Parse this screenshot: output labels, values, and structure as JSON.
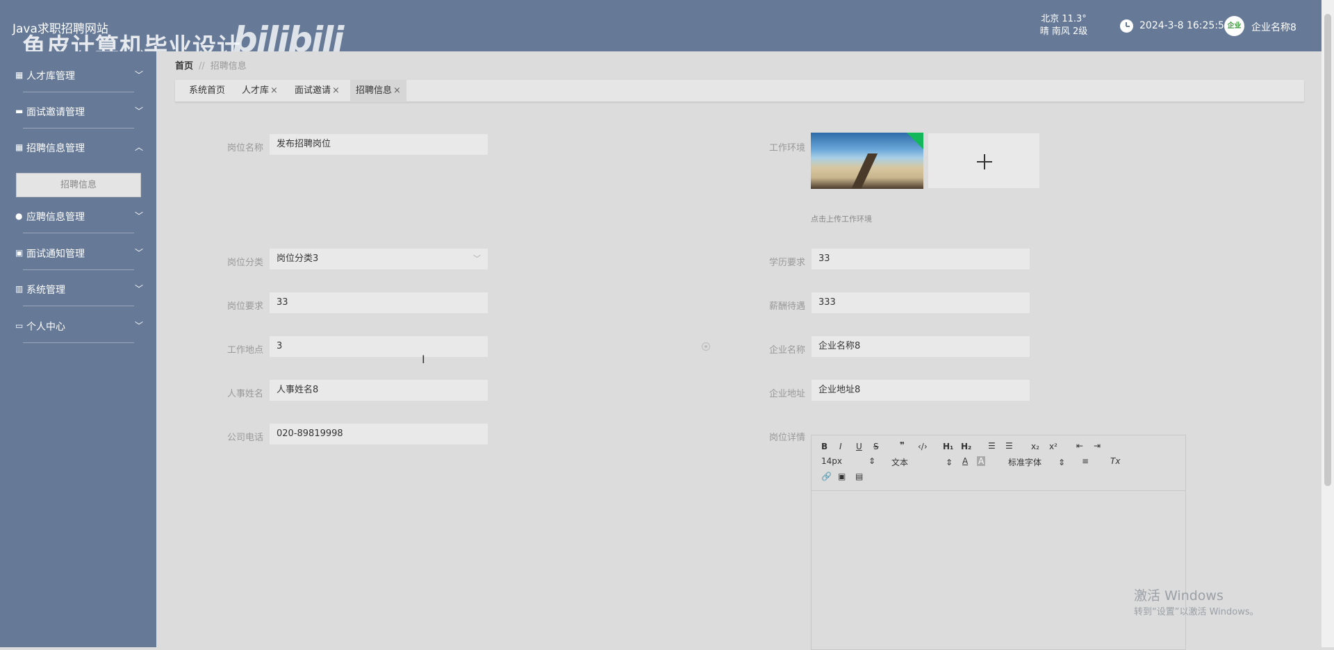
{
  "app": {
    "title": "Java求职招聘网站",
    "watermark_text": "鱼皮计算机毕业设计",
    "watermark_logo": "bilibili"
  },
  "header": {
    "weather_city": "北京 11.3°",
    "weather_desc": "晴 南风 2级",
    "datetime": "2024-3-8 16:25:54",
    "avatar_text": "企业",
    "user_name": "企业名称8"
  },
  "sidebar": {
    "items": [
      {
        "label": "人才库管理",
        "icon": "grid-icon",
        "expanded": false
      },
      {
        "label": "面试邀请管理",
        "icon": "monitor-icon",
        "expanded": false
      },
      {
        "label": "招聘信息管理",
        "icon": "grid-icon",
        "expanded": true
      },
      {
        "label": "应聘信息管理",
        "icon": "user-icon",
        "expanded": false
      },
      {
        "label": "面试通知管理",
        "icon": "chart-icon",
        "expanded": false
      },
      {
        "label": "系统管理",
        "icon": "bar-chart-icon",
        "expanded": false
      },
      {
        "label": "个人中心",
        "icon": "card-icon",
        "expanded": false
      }
    ],
    "submenu_active": "招聘信息"
  },
  "breadcrumb": {
    "home": "首页",
    "separator": "//",
    "current": "招聘信息"
  },
  "tabs": [
    {
      "label": "系统首页",
      "closable": false
    },
    {
      "label": "人才库",
      "closable": true
    },
    {
      "label": "面试邀请",
      "closable": true
    },
    {
      "label": "招聘信息",
      "closable": true,
      "active": true
    }
  ],
  "tab_close_glyph": "×",
  "form": {
    "job_name_label": "岗位名称",
    "job_name": "发布招聘岗位",
    "work_env_label": "工作环境",
    "upload_tip": "点击上传工作环境",
    "job_category_label": "岗位分类",
    "job_category": "岗位分类3",
    "education_label": "学历要求",
    "education": "33",
    "job_requirement_label": "岗位要求",
    "job_requirement": "33",
    "salary_label": "薪酬待遇",
    "salary": "333",
    "work_location_label": "工作地点",
    "work_location": "3",
    "company_name_label": "企业名称",
    "company_name": "企业名称8",
    "hr_name_label": "人事姓名",
    "hr_name": "人事姓名8",
    "company_address_label": "企业地址",
    "company_address": "企业地址8",
    "company_phone_label": "公司电话",
    "company_phone": "020-89819998",
    "job_detail_label": "岗位详情"
  },
  "editor": {
    "font_size": "14px",
    "header_select": "文本",
    "font_family": "标准字体"
  },
  "windows_activation": {
    "title": "激活 Windows",
    "subtitle": "转到“设置”以激活 Windows。"
  },
  "colors": {
    "sidebar": "#667a97",
    "upload_corner": "#14b85a"
  }
}
